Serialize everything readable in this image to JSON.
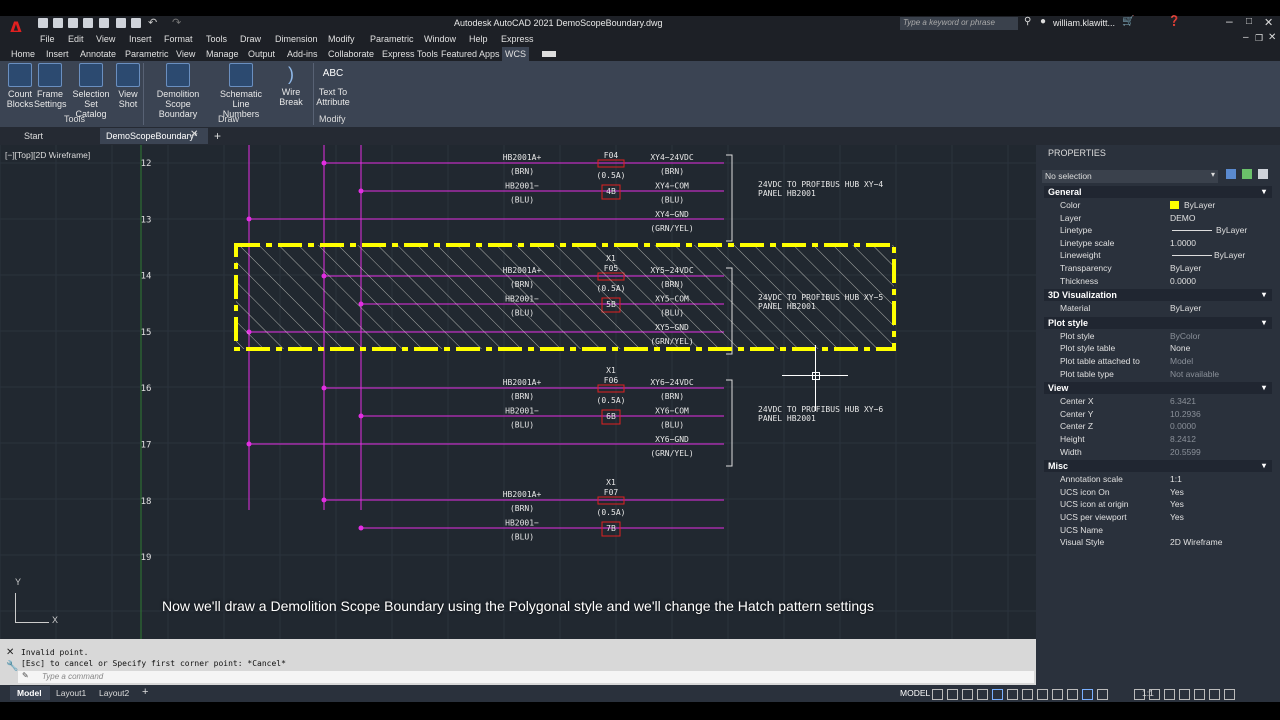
{
  "app": {
    "title": "Autodesk AutoCAD 2021   DemoScopeBoundary.dwg",
    "search_placeholder": "Type a keyword or phrase",
    "user": "william.klawitt..."
  },
  "menu": [
    "File",
    "Edit",
    "View",
    "Insert",
    "Format",
    "Tools",
    "Draw",
    "Dimension",
    "Modify",
    "Parametric",
    "Window",
    "Help",
    "Express"
  ],
  "ribbon_tabs": [
    "Home",
    "Insert",
    "Annotate",
    "Parametric",
    "View",
    "Manage",
    "Output",
    "Add-ins",
    "Collaborate",
    "Express Tools",
    "Featured Apps",
    "WCS"
  ],
  "ribbon": {
    "tools_buttons": [
      {
        "l1": "Count",
        "l2": "Blocks"
      },
      {
        "l1": "Frame",
        "l2": "Settings"
      },
      {
        "l1": "Selection Set",
        "l2": "Catalog"
      },
      {
        "l1": "View",
        "l2": "Shot"
      }
    ],
    "draw_buttons": [
      {
        "l1": "Demolition Scope",
        "l2": "Boundary"
      },
      {
        "l1": "Schematic Line",
        "l2": "Numbers"
      },
      {
        "l1": "Wire Break",
        "l2": ""
      }
    ],
    "modify_buttons": [
      {
        "l1": "Text To",
        "l2": "Attribute",
        "icon": "ABC"
      }
    ],
    "panels": [
      "Tools",
      "Draw",
      "Modify"
    ]
  },
  "doc_tabs": [
    "Start",
    "DemoScopeBoundary*"
  ],
  "viewport_label": "[−][Top][2D Wireframe]",
  "rows": [
    "12",
    "13",
    "14",
    "15",
    "16",
    "17",
    "18",
    "19"
  ],
  "drawing": {
    "circuits": [
      {
        "id": "F04",
        "x1": "",
        "fuse": "F04",
        "amps": "(0.5A)",
        "tag": "4B",
        "xy": [
          "XY4−24VDC",
          "(BRN)",
          "XY4−COM",
          "(BLU)",
          "XY4−GND",
          "(GRN/YEL)"
        ],
        "note1": "24VDC TO PROFIBUS HUB XY−4",
        "note2": "PANEL HB2001"
      },
      {
        "id": "F05",
        "x1": "X1",
        "fuse": "F05",
        "amps": "(0.5A)",
        "tag": "5B",
        "xy": [
          "XY5−24VDC",
          "(BRN)",
          "XY5−COM",
          "(BLU)",
          "XY5−GND",
          "(GRN/YEL)"
        ],
        "note1": "24VDC TO PROFIBUS HUB XY−5",
        "note2": "PANEL HB2001"
      },
      {
        "id": "F06",
        "x1": "X1",
        "fuse": "F06",
        "amps": "(0.5A)",
        "tag": "6B",
        "xy": [
          "XY6−24VDC",
          "(BRN)",
          "XY6−COM",
          "(BLU)",
          "XY6−GND",
          "(GRN/YEL)"
        ],
        "note1": "24VDC TO PROFIBUS HUB XY−6",
        "note2": "PANEL HB2001"
      },
      {
        "id": "F07",
        "x1": "X1",
        "fuse": "F07",
        "amps": "(0.5A)",
        "tag": "7B",
        "xy": [],
        "note1": "",
        "note2": ""
      }
    ],
    "hb": [
      "HB2001A+",
      "(BRN)",
      "HB2001−",
      "(BLU)"
    ]
  },
  "caption": "Now we'll draw a Demolition Scope Boundary using the Polygonal style and we'll change the Hatch pattern settings",
  "properties": {
    "title": "PROPERTIES",
    "selection": "No selection",
    "sections": [
      {
        "name": "General",
        "rows": [
          {
            "k": "Color",
            "v": "ByLayer",
            "swatch": "#ffff00"
          },
          {
            "k": "Layer",
            "v": "DEMO"
          },
          {
            "k": "Linetype",
            "v": "ByLayer",
            "line": true
          },
          {
            "k": "Linetype scale",
            "v": "1.0000"
          },
          {
            "k": "Lineweight",
            "v": "ByLayer",
            "line": true
          },
          {
            "k": "Transparency",
            "v": "ByLayer"
          },
          {
            "k": "Thickness",
            "v": "0.0000"
          }
        ]
      },
      {
        "name": "3D Visualization",
        "rows": [
          {
            "k": "Material",
            "v": "ByLayer"
          }
        ]
      },
      {
        "name": "Plot style",
        "rows": [
          {
            "k": "Plot style",
            "v": "ByColor",
            "dim": true
          },
          {
            "k": "Plot style table",
            "v": "None"
          },
          {
            "k": "Plot table attached to",
            "v": "Model",
            "dim": true
          },
          {
            "k": "Plot table type",
            "v": "Not available",
            "dim": true
          }
        ]
      },
      {
        "name": "View",
        "rows": [
          {
            "k": "Center X",
            "v": "6.3421",
            "dim": true
          },
          {
            "k": "Center Y",
            "v": "10.2936",
            "dim": true
          },
          {
            "k": "Center Z",
            "v": "0.0000",
            "dim": true
          },
          {
            "k": "Height",
            "v": "8.2412",
            "dim": true
          },
          {
            "k": "Width",
            "v": "20.5599",
            "dim": true
          }
        ]
      },
      {
        "name": "Misc",
        "rows": [
          {
            "k": "Annotation scale",
            "v": "1:1"
          },
          {
            "k": "UCS icon On",
            "v": "Yes"
          },
          {
            "k": "UCS icon at origin",
            "v": "Yes"
          },
          {
            "k": "UCS per viewport",
            "v": "Yes"
          },
          {
            "k": "UCS Name",
            "v": ""
          },
          {
            "k": "Visual Style",
            "v": "2D Wireframe"
          }
        ]
      }
    ]
  },
  "command": {
    "history1": "Invalid point.",
    "history2": "[Esc] to cancel or Specify first corner point: *Cancel*",
    "placeholder": "Type a command"
  },
  "layout_tabs": [
    "Model",
    "Layout1",
    "Layout2"
  ],
  "status_model": "MODEL",
  "scale": "1:1",
  "colors": {
    "magenta": "#e22ee2",
    "yellow": "#ffff00",
    "red": "#e02020",
    "text": "#e8e8e8",
    "background": "#212830"
  }
}
